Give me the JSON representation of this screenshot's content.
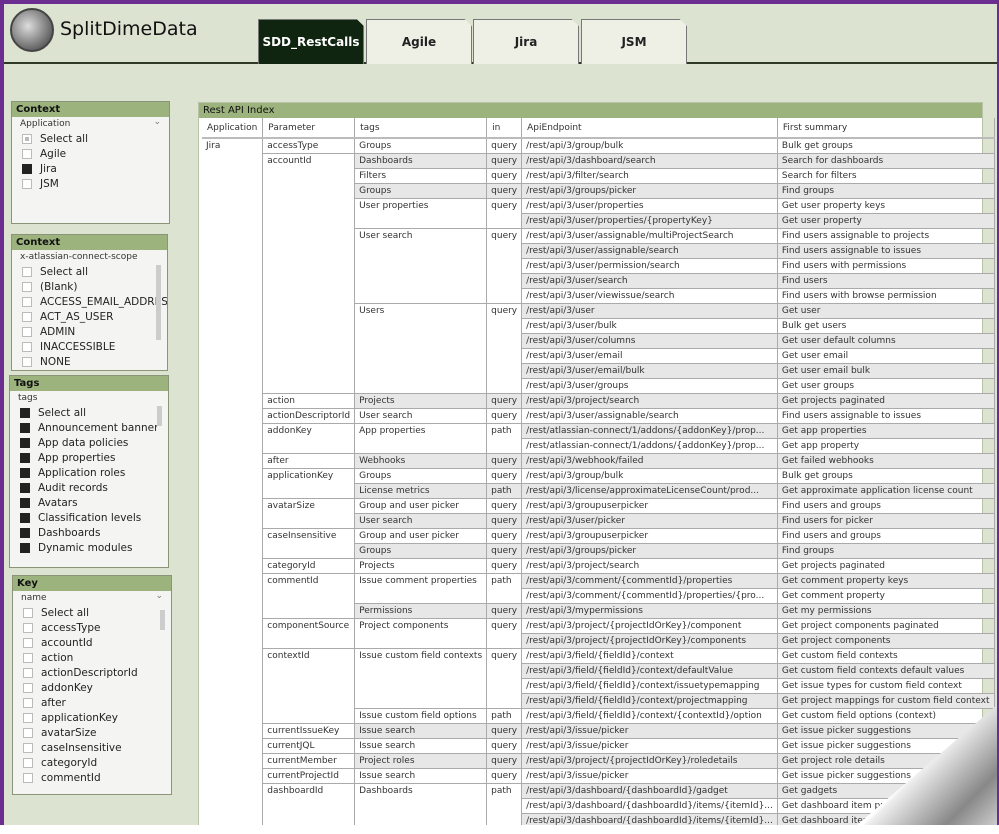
{
  "brand": "SplitDimeData",
  "tabs": [
    {
      "label": "SDD_RestCalls",
      "active": true
    },
    {
      "label": "Agile"
    },
    {
      "label": "Jira"
    },
    {
      "label": "JSM"
    }
  ],
  "filters": [
    {
      "title": "Context",
      "field": "Application",
      "dropdown": true,
      "items": [
        {
          "label": "Select all",
          "state": "partial"
        },
        {
          "label": "Agile",
          "state": "off"
        },
        {
          "label": "Jira",
          "state": "on"
        },
        {
          "label": "JSM",
          "state": "off"
        }
      ]
    },
    {
      "title": "Context",
      "field": "x-atlassian-connect-scope",
      "items": [
        {
          "label": "Select all",
          "state": "off"
        },
        {
          "label": "(Blank)",
          "state": "off"
        },
        {
          "label": "ACCESS_EMAIL_ADDRESSES",
          "state": "off"
        },
        {
          "label": "ACT_AS_USER",
          "state": "off"
        },
        {
          "label": "ADMIN",
          "state": "off"
        },
        {
          "label": "INACCESSIBLE",
          "state": "off"
        },
        {
          "label": "NONE",
          "state": "off"
        }
      ]
    },
    {
      "title": "Tags",
      "field": "tags",
      "items": [
        {
          "label": "Select all",
          "state": "on"
        },
        {
          "label": "Announcement banner",
          "state": "on"
        },
        {
          "label": "App data policies",
          "state": "on"
        },
        {
          "label": "App properties",
          "state": "on"
        },
        {
          "label": "Application roles",
          "state": "on"
        },
        {
          "label": "Audit records",
          "state": "on"
        },
        {
          "label": "Avatars",
          "state": "on"
        },
        {
          "label": "Classification levels",
          "state": "on"
        },
        {
          "label": "Dashboards",
          "state": "on"
        },
        {
          "label": "Dynamic modules",
          "state": "on"
        }
      ]
    },
    {
      "title": "Key",
      "field": "name",
      "dropdown": true,
      "items": [
        {
          "label": "Select all",
          "state": "off"
        },
        {
          "label": "accessType",
          "state": "off"
        },
        {
          "label": "accountId",
          "state": "off"
        },
        {
          "label": "action",
          "state": "off"
        },
        {
          "label": "actionDescriptorId",
          "state": "off"
        },
        {
          "label": "addonKey",
          "state": "off"
        },
        {
          "label": "after",
          "state": "off"
        },
        {
          "label": "applicationKey",
          "state": "off"
        },
        {
          "label": "avatarSize",
          "state": "off"
        },
        {
          "label": "caseInsensitive",
          "state": "off"
        },
        {
          "label": "categoryId",
          "state": "off"
        },
        {
          "label": "commentId",
          "state": "off"
        }
      ]
    }
  ],
  "report": {
    "title": "Rest API Index",
    "columns": [
      "Application",
      "Parameter",
      "tags",
      "in",
      "ApiEndpoint",
      "First summary"
    ],
    "application": "Jira",
    "params": [
      {
        "name": "accessType",
        "tags": [
          {
            "tag": "Groups",
            "in": "query",
            "eps": [
              [
                "/rest/api/3/group/bulk",
                "Bulk get groups"
              ]
            ]
          }
        ]
      },
      {
        "name": "accountId",
        "tags": [
          {
            "tag": "Dashboards",
            "in": "query",
            "eps": [
              [
                "/rest/api/3/dashboard/search",
                "Search for dashboards"
              ]
            ]
          },
          {
            "tag": "Filters",
            "in": "query",
            "eps": [
              [
                "/rest/api/3/filter/search",
                "Search for filters"
              ]
            ]
          },
          {
            "tag": "Groups",
            "in": "query",
            "eps": [
              [
                "/rest/api/3/groups/picker",
                "Find groups"
              ]
            ]
          },
          {
            "tag": "User properties",
            "in": "query",
            "eps": [
              [
                "/rest/api/3/user/properties",
                "Get user property keys"
              ],
              [
                "/rest/api/3/user/properties/{propertyKey}",
                "Get user property"
              ]
            ]
          },
          {
            "tag": "User search",
            "in": "query",
            "eps": [
              [
                "/rest/api/3/user/assignable/multiProjectSearch",
                "Find users assignable to projects"
              ],
              [
                "/rest/api/3/user/assignable/search",
                "Find users assignable to issues"
              ],
              [
                "/rest/api/3/user/permission/search",
                "Find users with permissions"
              ],
              [
                "/rest/api/3/user/search",
                "Find users"
              ],
              [
                "/rest/api/3/user/viewissue/search",
                "Find users with browse permission"
              ]
            ]
          },
          {
            "tag": "Users",
            "in": "query",
            "eps": [
              [
                "/rest/api/3/user",
                "Get user"
              ],
              [
                "/rest/api/3/user/bulk",
                "Bulk get users"
              ],
              [
                "/rest/api/3/user/columns",
                "Get user default columns"
              ],
              [
                "/rest/api/3/user/email",
                "Get user email"
              ],
              [
                "/rest/api/3/user/email/bulk",
                "Get user email bulk"
              ],
              [
                "/rest/api/3/user/groups",
                "Get user groups"
              ]
            ]
          }
        ]
      },
      {
        "name": "action",
        "tags": [
          {
            "tag": "Projects",
            "in": "query",
            "eps": [
              [
                "/rest/api/3/project/search",
                "Get projects paginated"
              ]
            ]
          }
        ]
      },
      {
        "name": "actionDescriptorId",
        "tags": [
          {
            "tag": "User search",
            "in": "query",
            "eps": [
              [
                "/rest/api/3/user/assignable/search",
                "Find users assignable to issues"
              ]
            ]
          }
        ]
      },
      {
        "name": "addonKey",
        "tags": [
          {
            "tag": "App properties",
            "in": "path",
            "eps": [
              [
                "/rest/atlassian-connect/1/addons/{addonKey}/prop...",
                "Get app properties"
              ],
              [
                "/rest/atlassian-connect/1/addons/{addonKey}/prop...",
                "Get app property"
              ]
            ]
          }
        ]
      },
      {
        "name": "after",
        "tags": [
          {
            "tag": "Webhooks",
            "in": "query",
            "eps": [
              [
                "/rest/api/3/webhook/failed",
                "Get failed webhooks"
              ]
            ]
          }
        ]
      },
      {
        "name": "applicationKey",
        "tags": [
          {
            "tag": "Groups",
            "in": "query",
            "eps": [
              [
                "/rest/api/3/group/bulk",
                "Bulk get groups"
              ]
            ]
          },
          {
            "tag": "License metrics",
            "in": "path",
            "eps": [
              [
                "/rest/api/3/license/approximateLicenseCount/prod...",
                "Get approximate application license count"
              ]
            ]
          }
        ]
      },
      {
        "name": "avatarSize",
        "tags": [
          {
            "tag": "Group and user picker",
            "in": "query",
            "eps": [
              [
                "/rest/api/3/groupuserpicker",
                "Find users and groups"
              ]
            ]
          },
          {
            "tag": "User search",
            "in": "query",
            "eps": [
              [
                "/rest/api/3/user/picker",
                "Find users for picker"
              ]
            ]
          }
        ]
      },
      {
        "name": "caseInsensitive",
        "tags": [
          {
            "tag": "Group and user picker",
            "in": "query",
            "eps": [
              [
                "/rest/api/3/groupuserpicker",
                "Find users and groups"
              ]
            ]
          },
          {
            "tag": "Groups",
            "in": "query",
            "eps": [
              [
                "/rest/api/3/groups/picker",
                "Find groups"
              ]
            ]
          }
        ]
      },
      {
        "name": "categoryId",
        "tags": [
          {
            "tag": "Projects",
            "in": "query",
            "eps": [
              [
                "/rest/api/3/project/search",
                "Get projects paginated"
              ]
            ]
          }
        ]
      },
      {
        "name": "commentId",
        "tags": [
          {
            "tag": "Issue comment properties",
            "in": "path",
            "eps": [
              [
                "/rest/api/3/comment/{commentId}/properties",
                "Get comment property keys"
              ],
              [
                "/rest/api/3/comment/{commentId}/properties/{pro...",
                "Get comment property"
              ]
            ]
          },
          {
            "tag": "Permissions",
            "in": "query",
            "eps": [
              [
                "/rest/api/3/mypermissions",
                "Get my permissions"
              ]
            ]
          }
        ]
      },
      {
        "name": "componentSource",
        "tags": [
          {
            "tag": "Project components",
            "in": "query",
            "eps": [
              [
                "/rest/api/3/project/{projectIdOrKey}/component",
                "Get project components paginated"
              ],
              [
                "/rest/api/3/project/{projectIdOrKey}/components",
                "Get project components"
              ]
            ]
          }
        ]
      },
      {
        "name": "contextId",
        "tags": [
          {
            "tag": "Issue custom field contexts",
            "in": "query",
            "eps": [
              [
                "/rest/api/3/field/{fieldId}/context",
                "Get custom field contexts"
              ],
              [
                "/rest/api/3/field/{fieldId}/context/defaultValue",
                "Get custom field contexts default values"
              ],
              [
                "/rest/api/3/field/{fieldId}/context/issuetypemapping",
                "Get issue types for custom field context"
              ],
              [
                "/rest/api/3/field/{fieldId}/context/projectmapping",
                "Get project mappings for custom field context"
              ]
            ]
          },
          {
            "tag": "Issue custom field options",
            "in": "path",
            "eps": [
              [
                "/rest/api/3/field/{fieldId}/context/{contextId}/option",
                "Get custom field options (context)"
              ]
            ]
          }
        ]
      },
      {
        "name": "currentIssueKey",
        "tags": [
          {
            "tag": "Issue search",
            "in": "query",
            "eps": [
              [
                "/rest/api/3/issue/picker",
                "Get issue picker suggestions"
              ]
            ]
          }
        ]
      },
      {
        "name": "currentJQL",
        "tags": [
          {
            "tag": "Issue search",
            "in": "query",
            "eps": [
              [
                "/rest/api/3/issue/picker",
                "Get issue picker suggestions"
              ]
            ]
          }
        ]
      },
      {
        "name": "currentMember",
        "tags": [
          {
            "tag": "Project roles",
            "in": "query",
            "eps": [
              [
                "/rest/api/3/project/{projectIdOrKey}/roledetails",
                "Get project role details"
              ]
            ]
          }
        ]
      },
      {
        "name": "currentProjectId",
        "tags": [
          {
            "tag": "Issue search",
            "in": "query",
            "eps": [
              [
                "/rest/api/3/issue/picker",
                "Get issue picker suggestions"
              ]
            ]
          }
        ]
      },
      {
        "name": "dashboardId",
        "tags": [
          {
            "tag": "Dashboards",
            "in": "path",
            "eps": [
              [
                "/rest/api/3/dashboard/{dashboardId}/gadget",
                "Get gadgets"
              ],
              [
                "/rest/api/3/dashboard/{dashboardId}/items/{itemId}...",
                "Get dashboard item property keys"
              ],
              [
                "/rest/api/3/dashboard/{dashboardId}/items/{itemId}...",
                "Get dashboard item property"
              ]
            ]
          }
        ]
      }
    ]
  }
}
